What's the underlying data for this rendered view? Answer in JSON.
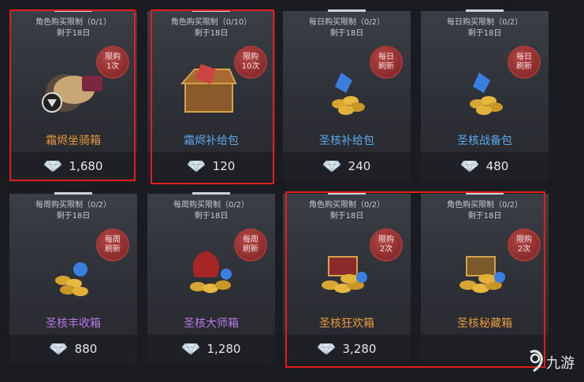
{
  "cards": [
    {
      "limit": "角色购买限制（0/1）",
      "remain": "剩于18日",
      "stamp": [
        "限购",
        "1次"
      ],
      "name": "霜烬坐骑箱",
      "price": "1,680",
      "name_color": "#e89a3c"
    },
    {
      "limit": "角色购买限制（0/10）",
      "remain": "剩于18日",
      "stamp": [
        "限购",
        "10次"
      ],
      "name": "霜烬补给包",
      "price": "120",
      "name_color": "#5ea8ea"
    },
    {
      "limit": "每日购买限制（0/2）",
      "remain": "剩于18日",
      "stamp": [
        "每日",
        "刷新"
      ],
      "name": "圣核补给包",
      "price": "240",
      "name_color": "#5ea8ea"
    },
    {
      "limit": "每日购买限制（0/2）",
      "remain": "剩于18日",
      "stamp": [
        "每日",
        "刷新"
      ],
      "name": "圣核战备包",
      "price": "480",
      "name_color": "#5ea8ea"
    },
    {
      "limit": "每周购买限制（0/2）",
      "remain": "剩于18日",
      "stamp": [
        "每周",
        "刷新"
      ],
      "name": "圣核丰收箱",
      "price": "880",
      "name_color": "#b57ae8"
    },
    {
      "limit": "每周购买限制（0/2）",
      "remain": "剩于18日",
      "stamp": [
        "每周",
        "刷新"
      ],
      "name": "圣核大师箱",
      "price": "1,280",
      "name_color": "#b57ae8"
    },
    {
      "limit": "角色购买限制（0/2）",
      "remain": "剩于18日",
      "stamp": [
        "限购",
        "2次"
      ],
      "name": "圣核狂欢箱",
      "price": "3,280",
      "name_color": "#e89a3c"
    },
    {
      "limit": "角色购买限制（0/2）",
      "remain": "剩于18日",
      "stamp": [
        "限购",
        "2次"
      ],
      "name": "圣核秘藏箱",
      "price": "",
      "name_color": "#e89a3c"
    }
  ],
  "watermark": "九游",
  "icons": {
    "currency": "diamond-icon"
  },
  "colors": {
    "highlight": "#e11d1d",
    "stamp": "#8d2d2d"
  }
}
